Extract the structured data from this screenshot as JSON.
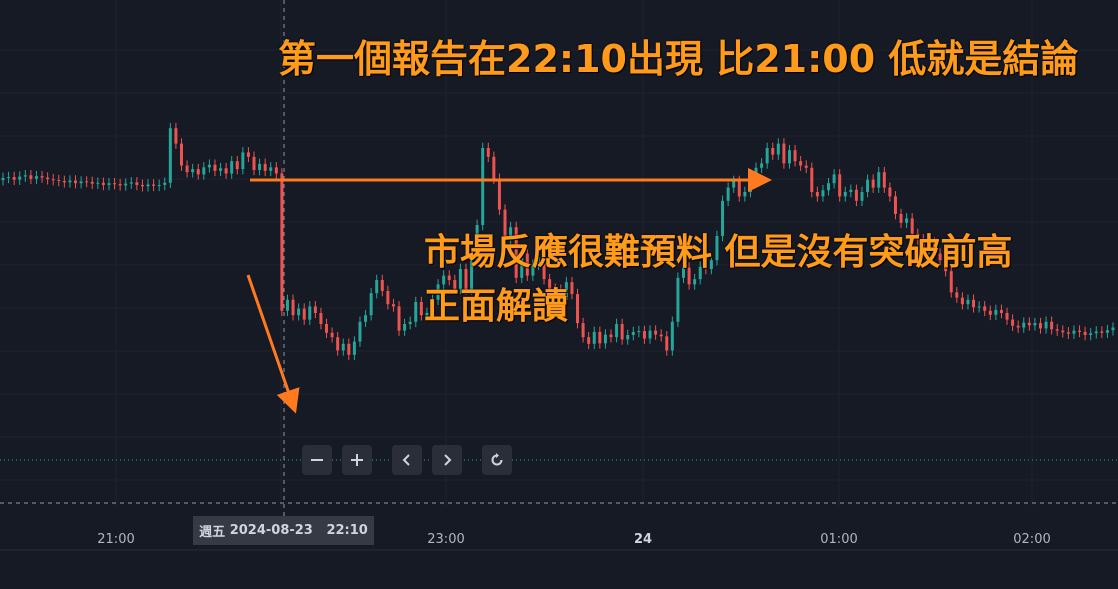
{
  "annotations": {
    "title": "第一個報告在22:10出現 比21:00 低就是結論",
    "comment_line1": "市場反應很難預料 但是沒有突破前高",
    "comment_line2": "正面解讀"
  },
  "crosshair": {
    "weekday": "週五",
    "date": "2024-08-23",
    "time": "22:10"
  },
  "toolbar": {
    "zoom_out": "minus-icon",
    "zoom_in": "plus-icon",
    "scroll_left": "chevron-left-icon",
    "scroll_right": "chevron-right-icon",
    "reset": "reset-icon"
  },
  "colors": {
    "background": "#161a25",
    "up": "#26a69a",
    "down": "#ef5350",
    "annotation": "#ff9a1a",
    "arrow": "#ff7a1f"
  },
  "chart_data": {
    "type": "candlestick",
    "x_axis_ticks": [
      {
        "label": "21:00",
        "bold": false
      },
      {
        "label": "23:00",
        "bold": false
      },
      {
        "label": "24",
        "bold": true
      },
      {
        "label": "01:00",
        "bold": false
      },
      {
        "label": "02:00",
        "bold": false
      }
    ],
    "price_axis": "hidden",
    "grid": true,
    "candles_close": [
      0.732,
      0.734,
      0.728,
      0.735,
      0.738,
      0.73,
      0.736,
      0.733,
      0.729,
      0.727,
      0.725,
      0.722,
      0.726,
      0.72,
      0.724,
      0.723,
      0.719,
      0.721,
      0.716,
      0.72,
      0.718,
      0.715,
      0.719,
      0.722,
      0.716,
      0.713,
      0.717,
      0.714,
      0.716,
      0.721,
      0.845,
      0.81,
      0.76,
      0.745,
      0.752,
      0.74,
      0.756,
      0.762,
      0.748,
      0.754,
      0.742,
      0.77,
      0.752,
      0.79,
      0.78,
      0.75,
      0.764,
      0.748,
      0.756,
      0.742,
      0.43,
      0.455,
      0.42,
      0.435,
      0.41,
      0.44,
      0.425,
      0.4,
      0.38,
      0.37,
      0.34,
      0.355,
      0.33,
      0.36,
      0.405,
      0.42,
      0.47,
      0.5,
      0.475,
      0.445,
      0.44,
      0.385,
      0.4,
      0.405,
      0.45,
      0.42,
      0.425,
      0.455,
      0.49,
      0.51,
      0.5,
      0.48,
      0.525,
      0.478,
      0.545,
      0.625,
      0.8,
      0.78,
      0.73,
      0.66,
      0.59,
      0.62,
      0.505,
      0.56,
      0.51,
      0.535,
      0.552,
      0.502,
      0.48,
      0.478,
      0.455,
      0.495,
      0.468,
      0.402,
      0.37,
      0.355,
      0.382,
      0.356,
      0.376,
      0.37,
      0.4,
      0.365,
      0.375,
      0.382,
      0.384,
      0.367,
      0.385,
      0.376,
      0.372,
      0.34,
      0.405,
      0.505,
      0.528,
      0.49,
      0.502,
      0.53,
      0.525,
      0.545,
      0.6,
      0.68,
      0.71,
      0.725,
      0.69,
      0.7,
      0.74,
      0.755,
      0.765,
      0.8,
      0.785,
      0.81,
      0.765,
      0.795,
      0.77,
      0.76,
      0.755,
      0.7,
      0.69,
      0.704,
      0.72,
      0.74,
      0.69,
      0.7,
      0.705,
      0.68,
      0.7,
      0.728,
      0.71,
      0.745,
      0.71,
      0.69,
      0.65,
      0.63,
      0.64,
      0.605,
      0.592,
      0.57,
      0.585,
      0.56,
      0.545,
      0.52,
      0.472,
      0.46,
      0.445,
      0.455,
      0.438,
      0.44,
      0.43,
      0.421,
      0.432,
      0.425,
      0.41,
      0.396,
      0.392,
      0.403,
      0.397,
      0.402,
      0.39,
      0.405,
      0.388,
      0.385,
      0.381,
      0.378,
      0.385,
      0.382,
      0.375,
      0.379,
      0.383,
      0.38,
      0.386,
      0.392
    ]
  }
}
